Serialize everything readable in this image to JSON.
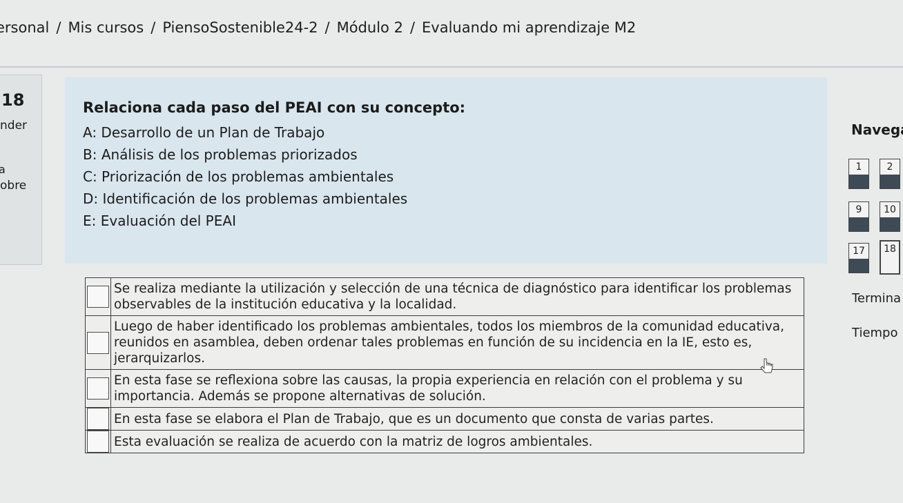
{
  "breadcrumb": [
    "ersonal",
    "Mis cursos",
    "PiensoSostenible24-2",
    "Módulo 2",
    "Evaluando mi aprendizaje M2"
  ],
  "breadcrumb_separator": "/",
  "question_info": {
    "number": "18",
    "text1": "nder",
    "text2": "a",
    "text3": "obre"
  },
  "question": {
    "title": "Relaciona cada paso del PEAI con su concepto:",
    "options": [
      "A: Desarrollo de un Plan de Trabajo",
      "B: Análisis de los problemas priorizados",
      "C: Priorización de los problemas ambientales",
      "D: Identificación de los problemas ambientales",
      "E: Evaluación del PEAI"
    ],
    "rows": [
      {
        "answer": "",
        "text": "Se realiza mediante la utilización y selección de una técnica de diagnóstico para identificar los problemas observables de la institución educativa y la localidad."
      },
      {
        "answer": "",
        "text": "Luego de haber identificado los problemas ambientales, todos los miembros de la comunidad educativa, reunidos en asamblea, deben ordenar tales problemas en función de su incidencia en la IE, esto es, jerarquizarlos."
      },
      {
        "answer": "",
        "text": "En esta fase se reflexiona sobre las causas, la propia experiencia en relación con el problema y su importancia. Además se propone alternativas de solución."
      },
      {
        "answer": "",
        "text": "En esta fase se elabora el Plan de Trabajo, que es un documento que consta de varias partes."
      },
      {
        "answer": "",
        "text": "Esta evaluación se realiza de acuerdo con la matriz de logros ambientales."
      }
    ]
  },
  "navigation": {
    "title": "Navega",
    "buttons": [
      {
        "label": "1",
        "answered": true,
        "current": false
      },
      {
        "label": "2",
        "answered": true,
        "current": false
      },
      {
        "label": "9",
        "answered": true,
        "current": false
      },
      {
        "label": "10",
        "answered": true,
        "current": false
      },
      {
        "label": "17",
        "answered": true,
        "current": false
      },
      {
        "label": "18",
        "answered": false,
        "current": true
      }
    ],
    "finish_label": "Termina",
    "time_label": "Tiempo"
  },
  "colors": {
    "question_bg": "#d9e6ee",
    "answered_fill": "#3e4a55",
    "page_bg": "#e9eaea"
  }
}
